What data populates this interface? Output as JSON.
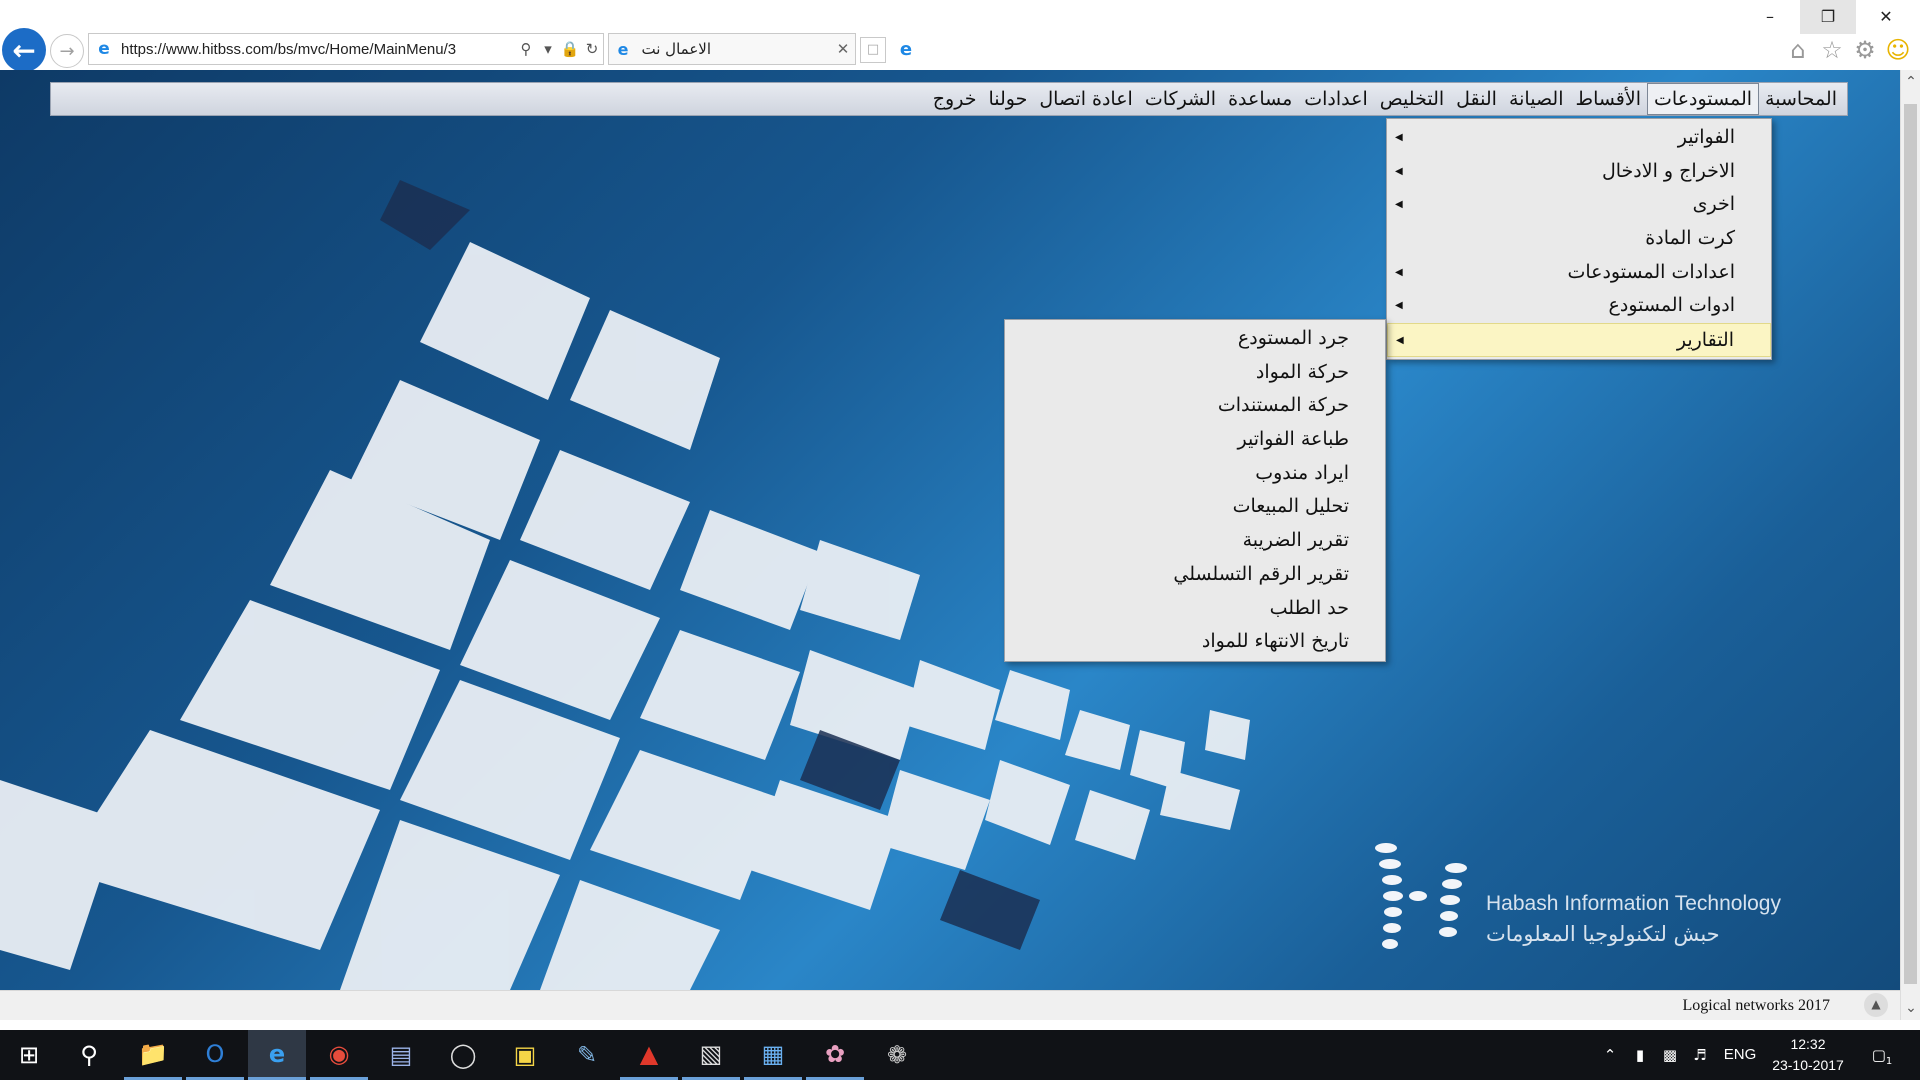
{
  "browser": {
    "url": "https://www.hitbss.com/bs/mvc/Home/MainMenu/3",
    "tab_title": "الاعمال نت"
  },
  "menubar": {
    "items": [
      {
        "label": "المحاسبة",
        "active": false
      },
      {
        "label": "المستودعات",
        "active": true
      },
      {
        "label": "الأقساط",
        "active": false
      },
      {
        "label": "الصيانة",
        "active": false
      },
      {
        "label": "النقل",
        "active": false
      },
      {
        "label": "التخليص",
        "active": false
      },
      {
        "label": "اعدادات",
        "active": false
      },
      {
        "label": "مساعدة",
        "active": false
      },
      {
        "label": "الشركات",
        "active": false
      },
      {
        "label": "اعادة اتصال",
        "active": false
      },
      {
        "label": "حولنا",
        "active": false
      },
      {
        "label": "خروج",
        "active": false
      }
    ]
  },
  "warehouse_menu": {
    "items": [
      {
        "label": "الفواتير",
        "has_submenu": true
      },
      {
        "label": "الاخراج و الادخال",
        "has_submenu": true
      },
      {
        "label": "اخرى",
        "has_submenu": true
      },
      {
        "label": "كرت المادة",
        "has_submenu": false
      },
      {
        "label": "اعدادات المستودعات",
        "has_submenu": true
      },
      {
        "label": "ادوات المستودع",
        "has_submenu": true
      },
      {
        "label": "التقارير",
        "has_submenu": true,
        "highlighted": true
      }
    ]
  },
  "reports_submenu": {
    "items": [
      {
        "label": "جرد المستودع"
      },
      {
        "label": "حركة المواد"
      },
      {
        "label": "حركة المستندات"
      },
      {
        "label": "طباعة الفواتير"
      },
      {
        "label": "ايراد مندوب"
      },
      {
        "label": "تحليل المبيعات"
      },
      {
        "label": "تقرير الضريبة"
      },
      {
        "label": "تقرير الرقم التسلسلي"
      },
      {
        "label": "حد الطلب"
      },
      {
        "label": "تاريخ الانتهاء للمواد"
      }
    ]
  },
  "logo": {
    "english": "Habash Information Technology",
    "arabic": "حبش لتكنولوجيا المعلومات"
  },
  "status": {
    "text": "Logical networks  2017"
  },
  "taskbar": {
    "language": "ENG",
    "time": "12:32",
    "date": "23-10-2017",
    "notification_count": "1"
  },
  "colors": {
    "menu_highlight": "#fbf5c4",
    "page_background": "#17578f",
    "browser_accent": "#1c6cc6"
  }
}
